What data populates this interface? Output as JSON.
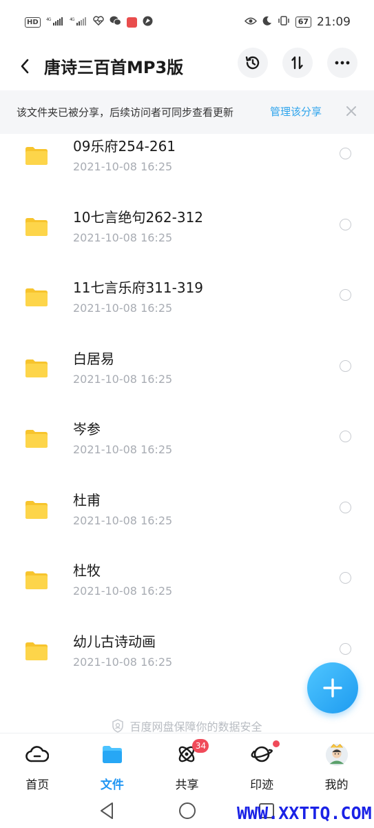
{
  "status_bar": {
    "left_items": [
      "HD",
      "4G",
      "4G"
    ],
    "battery": "67",
    "time": "21:09"
  },
  "header": {
    "title": "唐诗三百首MP3版",
    "back_icon": "chevron-left-icon",
    "history_icon": "history-icon",
    "sort_icon": "sort-icon",
    "more_icon": "more-icon"
  },
  "banner": {
    "text": "该文件夹已被分享，后续访问者可同步查看更新",
    "link": "管理该分享"
  },
  "files": [
    {
      "name": "09乐府254-261",
      "date": "2021-10-08  16:25"
    },
    {
      "name": "10七言绝句262-312",
      "date": "2021-10-08  16:25"
    },
    {
      "name": "11七言乐府311-319",
      "date": "2021-10-08  16:25"
    },
    {
      "name": "白居易",
      "date": "2021-10-08  16:25"
    },
    {
      "name": "岑参",
      "date": "2021-10-08  16:25"
    },
    {
      "name": "杜甫",
      "date": "2021-10-08  16:25"
    },
    {
      "name": "杜牧",
      "date": "2021-10-08  16:25"
    },
    {
      "name": "幼儿古诗动画",
      "date": "2021-10-08  16:25"
    }
  ],
  "security_note": "百度网盘保障你的数据安全",
  "nav": {
    "home": "首页",
    "files": "文件",
    "share": "共享",
    "share_badge": "34",
    "moments": "印迹",
    "mine": "我的"
  },
  "colors": {
    "accent": "#2196f3",
    "folder": "#fdd54a",
    "badge": "#f04b5a",
    "link": "#2ea4ec"
  },
  "watermark": "WWW.XXTTQ.COM"
}
